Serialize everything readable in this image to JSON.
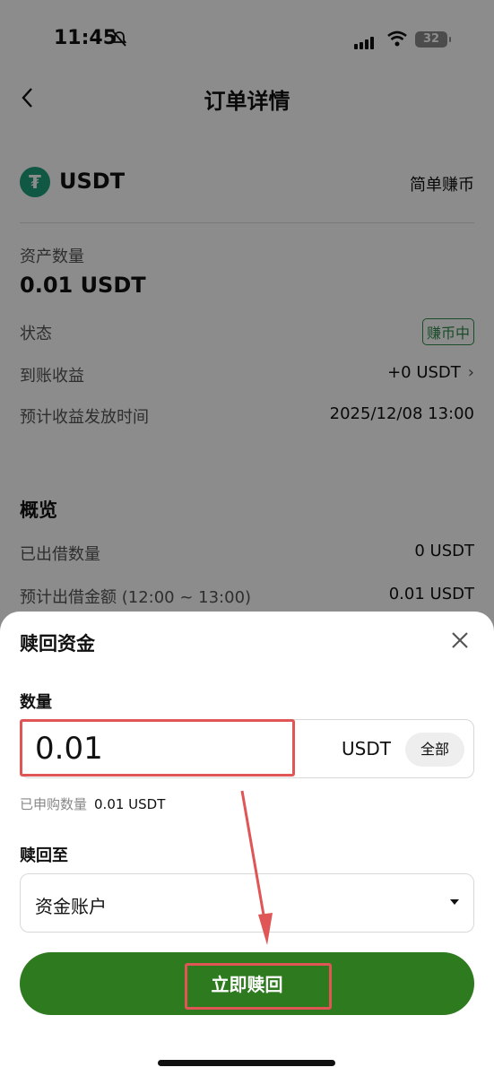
{
  "status_bar": {
    "time": "11:45",
    "battery": "32"
  },
  "header": {
    "title": "订单详情"
  },
  "asset": {
    "name": "USDT",
    "product": "简单赚币"
  },
  "details": {
    "amount_label": "资产数量",
    "amount_value": "0.01 USDT",
    "status_label": "状态",
    "status_value": "赚币中",
    "earnings_label": "到账收益",
    "earnings_value": "+0 USDT",
    "payout_time_label": "预计收益发放时间",
    "payout_time_value": "2025/12/08 13:00"
  },
  "overview": {
    "title": "概览",
    "lent_label": "已出借数量",
    "lent_value": "0 USDT",
    "est_lend_label": "预计出借金额 (12:00 ~ 13:00)",
    "est_lend_value": "0.01 USDT"
  },
  "sheet": {
    "title": "赎回资金",
    "quantity_label": "数量",
    "amount_value": "0.01",
    "unit": "USDT",
    "all_button": "全部",
    "subscribed_label": "已申购数量",
    "subscribed_value": "0.01 USDT",
    "redeem_to_label": "赎回至",
    "account_value": "资金账户",
    "redeem_button": "立即赎回"
  },
  "colors": {
    "accent_green": "#2d7a1f",
    "tether_green": "#1e9e7c",
    "annotation_red": "#e05555"
  }
}
